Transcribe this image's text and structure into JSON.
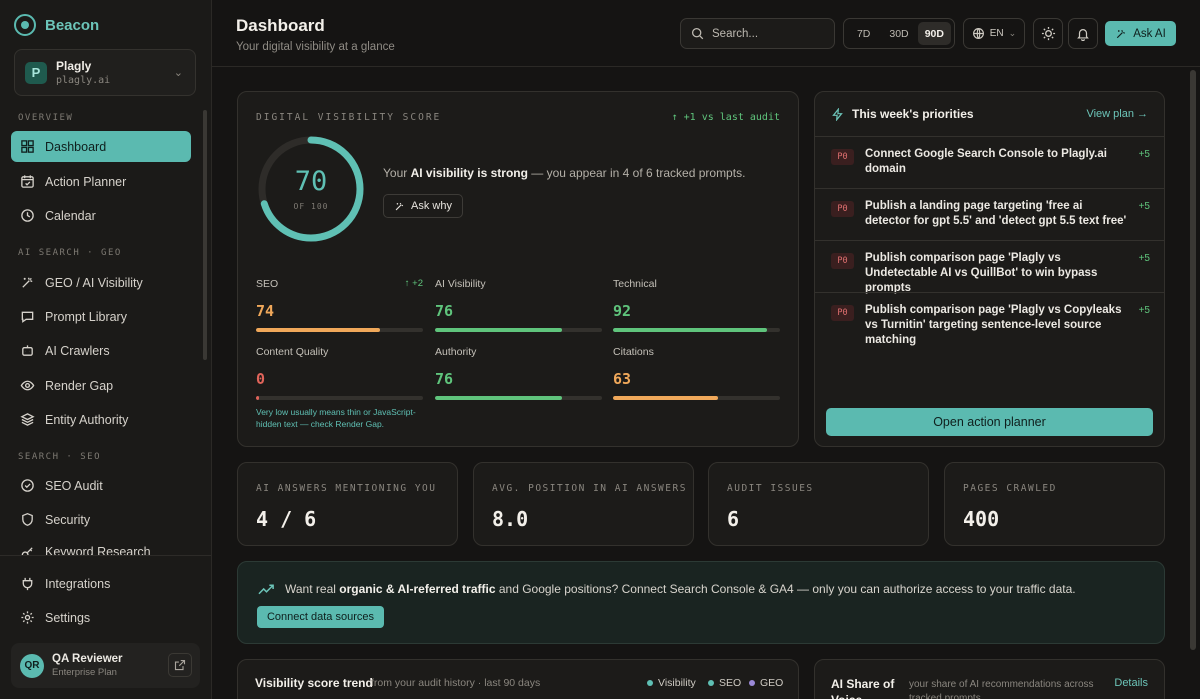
{
  "brand": {
    "name": "Beacon"
  },
  "project": {
    "name": "Plagly",
    "domain": "plagly.ai",
    "logo_letter": "P"
  },
  "sidebar": {
    "overview_label": "OVERVIEW",
    "ai_label": "AI SEARCH · GEO",
    "seo_label": "SEARCH · SEO",
    "items": [
      {
        "label": "Dashboard",
        "icon": "grid-icon",
        "active": true
      },
      {
        "label": "Action Planner",
        "icon": "calendar-check-icon"
      },
      {
        "label": "Calendar",
        "icon": "clock-icon"
      },
      {
        "label": "GEO / AI Visibility",
        "icon": "sparkle-icon"
      },
      {
        "label": "Prompt Library",
        "icon": "chat-icon"
      },
      {
        "label": "AI Crawlers",
        "icon": "bot-icon"
      },
      {
        "label": "Render Gap",
        "icon": "eye-icon"
      },
      {
        "label": "Entity Authority",
        "icon": "layers-icon"
      },
      {
        "label": "SEO Audit",
        "icon": "check-circle-icon"
      },
      {
        "label": "Security",
        "icon": "shield-icon"
      },
      {
        "label": "Keyword Research",
        "icon": "key-icon"
      },
      {
        "label": "Integrations",
        "icon": "plug-icon"
      },
      {
        "label": "Settings",
        "icon": "gear-icon"
      }
    ]
  },
  "user": {
    "initials": "QR",
    "name": "QA Reviewer",
    "plan": "Enterprise Plan"
  },
  "header": {
    "title": "Dashboard",
    "subtitle": "Your digital visibility at a glance",
    "search_placeholder": "Search...",
    "ranges": [
      "7D",
      "30D",
      "90D"
    ],
    "active_range": "90D",
    "lang": "EN",
    "ask_ai": "Ask AI"
  },
  "score": {
    "label": "DIGITAL VISIBILITY SCORE",
    "value": "70",
    "of": "OF 100",
    "fraction": 0.7,
    "delta": "↑ +1 vs last audit",
    "text_prefix": "Your ",
    "text_bold": "AI visibility is strong",
    "text_suffix": " — you appear in 4 of 6 tracked prompts.",
    "ask_why": "Ask why",
    "metrics": [
      {
        "name": "SEO",
        "value": "74",
        "pct": 74,
        "color": "#f0a85a",
        "delta": "↑ +2"
      },
      {
        "name": "AI Visibility",
        "value": "76",
        "pct": 76,
        "color": "#5fc47c"
      },
      {
        "name": "Technical",
        "value": "92",
        "pct": 92,
        "color": "#5fc47c"
      },
      {
        "name": "Content Quality",
        "value": "0",
        "pct": 2,
        "color": "#e0645a",
        "note": "Very low usually means thin or JavaScript-hidden text — check Render Gap."
      },
      {
        "name": "Authority",
        "value": "76",
        "pct": 76,
        "color": "#5fc47c"
      },
      {
        "name": "Citations",
        "value": "63",
        "pct": 63,
        "color": "#f0a85a"
      }
    ]
  },
  "priorities": {
    "title": "This week's priorities",
    "link": "View plan →",
    "button": "Open action planner",
    "items": [
      {
        "badge": "P0",
        "text": "Connect Google Search Console to Plagly.ai domain",
        "pts": "+5"
      },
      {
        "badge": "P0",
        "text": "Publish a landing page targeting 'free ai detector for gpt 5.5' and 'detect gpt 5.5 text free'",
        "pts": "+5"
      },
      {
        "badge": "P0",
        "text": "Publish comparison page 'Plagly vs Undetectable AI vs QuillBot' to win bypass prompts",
        "pts": "+5"
      },
      {
        "badge": "P0",
        "text": "Publish comparison page 'Plagly vs Copyleaks vs Turnitin' targeting sentence-level source matching",
        "pts": "+5"
      }
    ]
  },
  "stats": [
    {
      "label": "AI ANSWERS MENTIONING YOU",
      "value": "4 / 6"
    },
    {
      "label": "AVG. POSITION IN AI ANSWERS",
      "value": "8.0"
    },
    {
      "label": "AUDIT ISSUES",
      "value": "6"
    },
    {
      "label": "PAGES CRAWLED",
      "value": "400"
    }
  ],
  "banner": {
    "prefix": "Want real ",
    "bold": "organic & AI-referred traffic",
    "suffix": " and Google positions? Connect Search Console & GA4 — only you can authorize access to your traffic data.",
    "button": "Connect data sources"
  },
  "trend": {
    "title": "Visibility score trend",
    "subtitle": "from your audit history · last 90 days",
    "legend": [
      {
        "name": "Visibility",
        "color": "#5fc0b4"
      },
      {
        "name": "SEO",
        "color": "#5fc0b4"
      },
      {
        "name": "GEO",
        "color": "#9b8ad8"
      }
    ]
  },
  "share": {
    "title": "AI Share of Voice",
    "subtitle": "your share of AI recommendations across tracked prompts",
    "link": "Details"
  }
}
